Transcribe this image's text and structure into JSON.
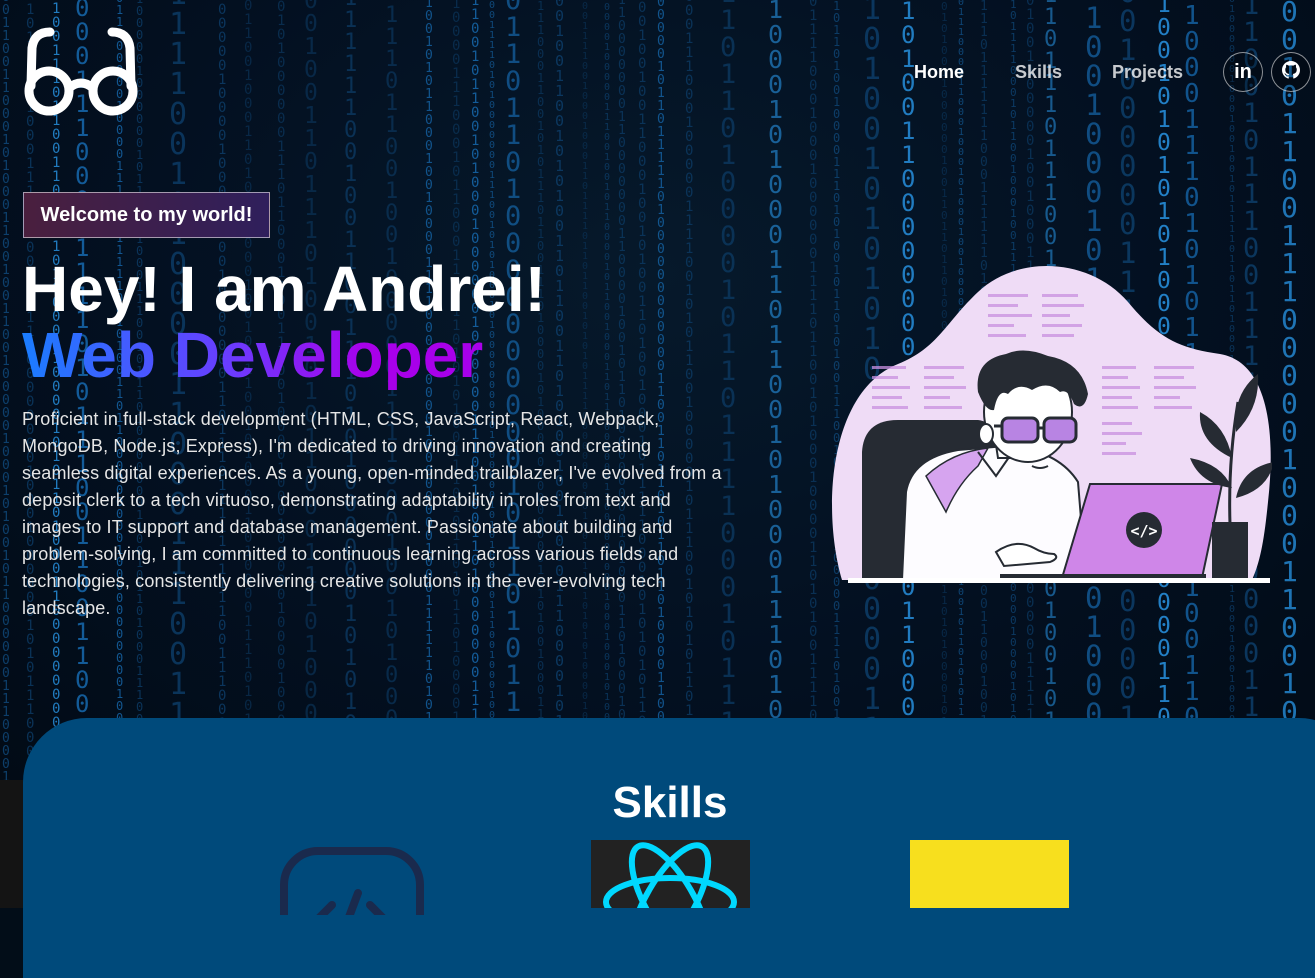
{
  "nav": {
    "logo_icon": "glasses-icon",
    "links": [
      {
        "label": "Home",
        "active": true
      },
      {
        "label": "Skills",
        "active": false
      },
      {
        "label": "Projects",
        "active": false
      }
    ],
    "social": [
      {
        "icon": "linkedin-icon",
        "glyph": "in"
      },
      {
        "icon": "github-icon"
      }
    ]
  },
  "hero": {
    "tagline": "Welcome to my world!",
    "heading": "Hey! I am Andrei!",
    "role": "Web Developer",
    "bio": "Proficient in full-stack development (HTML, CSS, JavaScript, React, Webpack, MongoDB, Node.js, Express), I'm dedicated to driving innovation and creating seamless digital experiences. As a young, open-minded trailblazer, I've evolved from a deposit clerk to a tech virtuoso, demonstrating adaptability in roles from text and images to IT support and database management. Passionate about building and problem-solving, I am committed to continuous learning across various fields and technologies, consistently delivering creative solutions in the ever-evolving tech landscape."
  },
  "skills": {
    "title": "Skills",
    "items": [
      {
        "icon": "code-icon"
      },
      {
        "icon": "react-icon"
      },
      {
        "icon": "javascript-icon"
      }
    ]
  },
  "colors": {
    "background": "#020d18",
    "skills_panel": "#004a7b",
    "accent_blue": "#1a7dff",
    "accent_purple": "#a800ea",
    "matrix_digit": "#1e8fe0"
  }
}
